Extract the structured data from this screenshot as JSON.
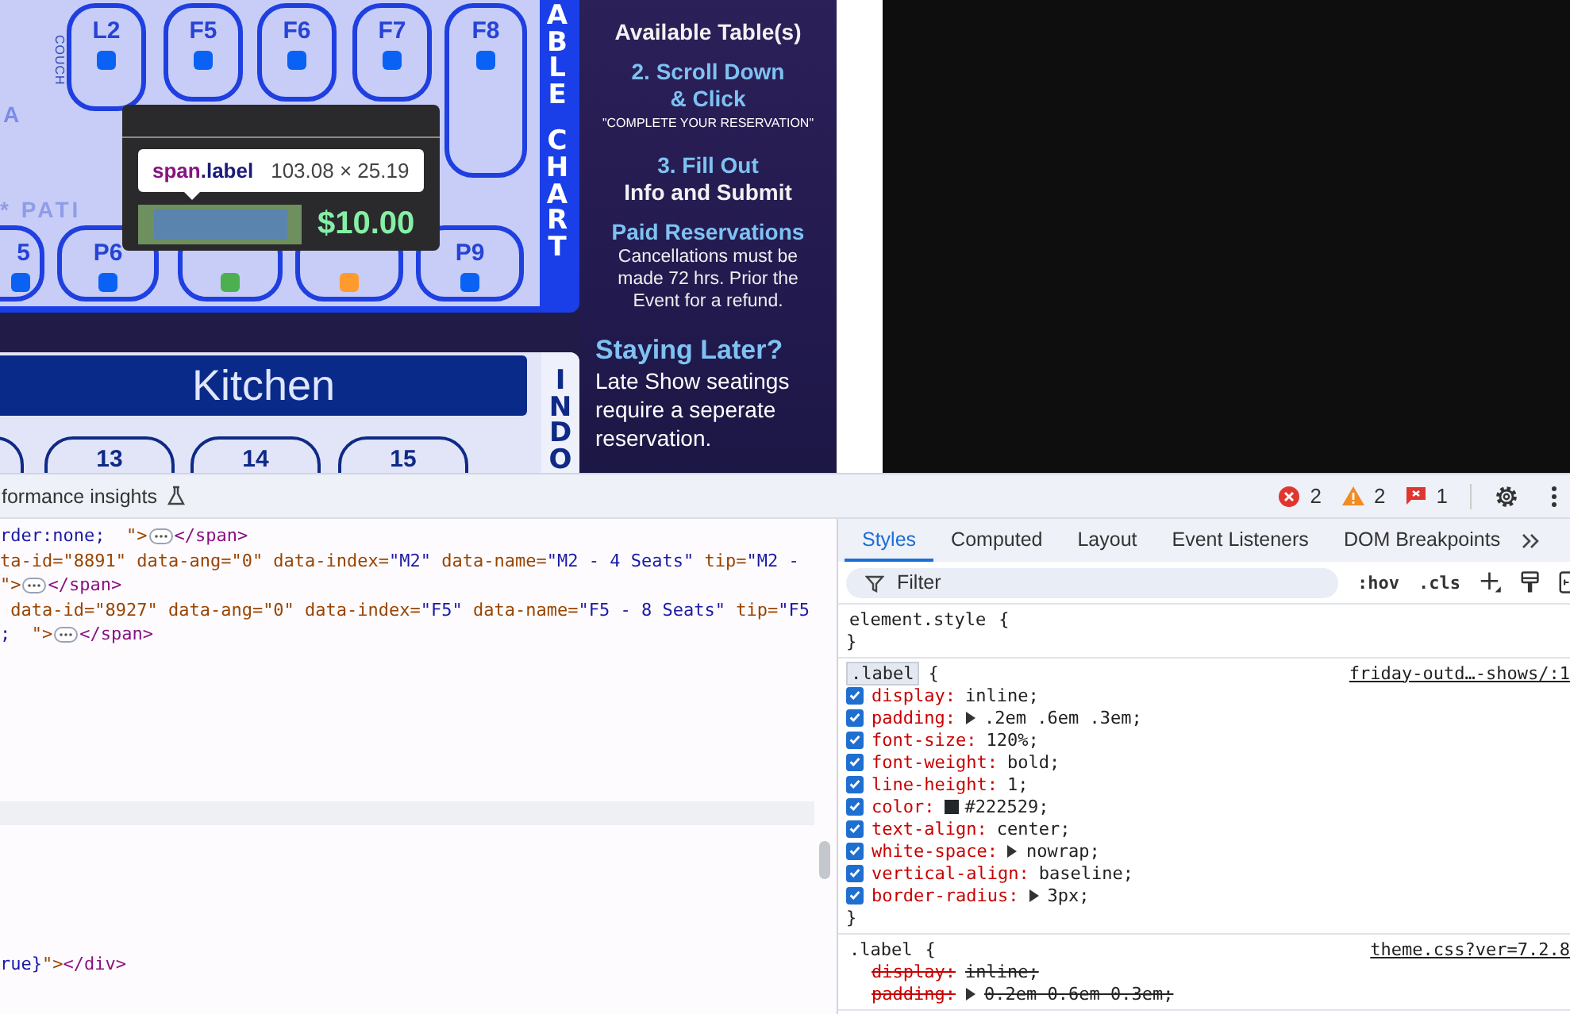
{
  "seat_chart": {
    "side_title": "ABLE CHART",
    "couch_label": "COUCH",
    "section_label": "A",
    "patio_label": "* PATI",
    "top_tables": [
      {
        "label": "L2",
        "color": "#0a62f5"
      },
      {
        "label": "F5",
        "color": "#0a62f5"
      },
      {
        "label": "F6",
        "color": "#0a62f5"
      },
      {
        "label": "F7",
        "color": "#0a62f5"
      },
      {
        "label": "F8",
        "color": "#0a62f5"
      }
    ],
    "bottom_tables": [
      {
        "label": "5",
        "color": "#0a62f5"
      },
      {
        "label": "P6",
        "color": "#0a62f5"
      },
      {
        "color": "#4caf50"
      },
      {
        "color": "#ff9a2e"
      },
      {
        "label": "P9",
        "color": "#0a62f5"
      }
    ],
    "tooltip": {
      "tag": "span",
      "class_name": ".label",
      "size": "103.08 × 25.19",
      "price": "$10.00"
    }
  },
  "kitchen": {
    "title": "Kitchen",
    "side_title": "INDO",
    "tables": [
      {
        "label": "13"
      },
      {
        "label": "14"
      },
      {
        "label": "15"
      }
    ]
  },
  "instructions": [
    {
      "kind": "body",
      "text": "Available Table(s)"
    },
    {
      "kind": "heading",
      "text": "2. Scroll Down"
    },
    {
      "kind": "heading",
      "text": "& Click"
    },
    {
      "kind": "caps",
      "text": "\"COMPLETE YOUR RESERVATION\""
    },
    {
      "kind": "heading",
      "text": "3. Fill Out"
    },
    {
      "kind": "body",
      "text": "Info and Submit"
    },
    {
      "kind": "heading",
      "text": "Paid Reservations"
    },
    {
      "kind": "note",
      "text": "Cancellations must be made 72 hrs. Prior the Event for a refund."
    },
    {
      "kind": "big_heading",
      "text": "Staying Later?"
    },
    {
      "kind": "big_body",
      "text": "Late Show seatings require a seperate reservation."
    }
  ],
  "devtools": {
    "panel_tab": "formance insights",
    "errors": "2",
    "warnings": "2",
    "issues": "1",
    "code_lines": [
      [
        {
          "kind": "value",
          "text": "rder:none;  "
        },
        {
          "kind": "attr",
          "text": "\">"
        },
        {
          "kind": "ellipsis"
        },
        {
          "kind": "tag",
          "text": "</span>"
        }
      ],
      [
        {
          "kind": "attr",
          "text": "ta-id=\"8891\" data-ang=\"0\" data-index="
        },
        {
          "kind": "value",
          "text": "\"M2\""
        },
        {
          "kind": "attr",
          "text": " data-name="
        },
        {
          "kind": "value",
          "text": "\"M2 - 4 Seats\""
        },
        {
          "kind": "attr",
          "text": " tip="
        },
        {
          "kind": "value",
          "text": "\"M2 -"
        }
      ],
      [
        {
          "kind": "attr",
          "text": "\">"
        },
        {
          "kind": "ellipsis"
        },
        {
          "kind": "tag",
          "text": "</span>"
        }
      ],
      [
        {
          "kind": "attr",
          "text": " data-id=\"8927\" data-ang=\"0\" data-index="
        },
        {
          "kind": "value",
          "text": "\"F5\""
        },
        {
          "kind": "attr",
          "text": " data-name="
        },
        {
          "kind": "value",
          "text": "\"F5 - 8 Seats\""
        },
        {
          "kind": "attr",
          "text": " tip="
        },
        {
          "kind": "value",
          "text": "\"F5"
        }
      ],
      [
        {
          "kind": "value",
          "text": ";  "
        },
        {
          "kind": "attr",
          "text": "\">"
        },
        {
          "kind": "ellipsis"
        },
        {
          "kind": "tag",
          "text": "</span>"
        }
      ]
    ],
    "lower_code_lines": [
      [
        {
          "kind": "value",
          "text": "rue}"
        },
        {
          "kind": "attr",
          "text": "\">"
        },
        {
          "kind": "tag",
          "text": "</div>"
        }
      ]
    ],
    "tabs": [
      {
        "label": "Styles",
        "selected": true
      },
      {
        "label": "Computed",
        "selected": false
      },
      {
        "label": "Layout",
        "selected": false
      },
      {
        "label": "Event Listeners",
        "selected": false
      },
      {
        "label": "DOM Breakpoints",
        "selected": false
      }
    ],
    "filter": {
      "placeholder": "Filter"
    },
    "toggles": [
      ":hov",
      ".cls"
    ],
    "rules": [
      {
        "selector": "element.style",
        "open": "{",
        "close": "}",
        "highlighted": false
      },
      {
        "selector": ".label",
        "open": "{",
        "close": "}",
        "highlighted": true,
        "source": "friday-outd…-shows/:1",
        "declarations": [
          {
            "name": "display:",
            "value": "inline;",
            "checked": true,
            "overridden": false,
            "expandable": false
          },
          {
            "name": "padding:",
            "value": ".2em .6em .3em;",
            "checked": true,
            "overridden": false,
            "expandable": true
          },
          {
            "name": "font-size:",
            "value": "120%;",
            "checked": true,
            "overridden": false,
            "expandable": false
          },
          {
            "name": "font-weight:",
            "value": "bold;",
            "checked": true,
            "overridden": false,
            "expandable": false
          },
          {
            "name": "line-height:",
            "value": "1;",
            "checked": true,
            "overridden": false,
            "expandable": false
          },
          {
            "name": "color:",
            "value": ";",
            "checked": true,
            "overridden": false,
            "expandable": false,
            "swatch": "#222529"
          },
          {
            "name": "text-align:",
            "value": "center;",
            "checked": true,
            "overridden": false,
            "expandable": false
          },
          {
            "name": "white-space:",
            "value": "nowrap;",
            "checked": true,
            "overridden": false,
            "expandable": true
          },
          {
            "name": "vertical-align:",
            "value": "baseline;",
            "checked": true,
            "overridden": false,
            "expandable": false
          },
          {
            "name": "border-radius:",
            "value": "3px;",
            "checked": true,
            "overridden": false,
            "expandable": true
          }
        ]
      },
      {
        "selector": ".label",
        "open": "{",
        "highlighted": false,
        "source": "theme.css?ver=7.2.8",
        "declarations": [
          {
            "name": "display:",
            "value": "inline;",
            "overridden": true,
            "expandable": false
          },
          {
            "name": "padding:",
            "value": "0.2em 0.6em 0.3em;",
            "overridden": true,
            "expandable": true
          }
        ]
      }
    ]
  }
}
